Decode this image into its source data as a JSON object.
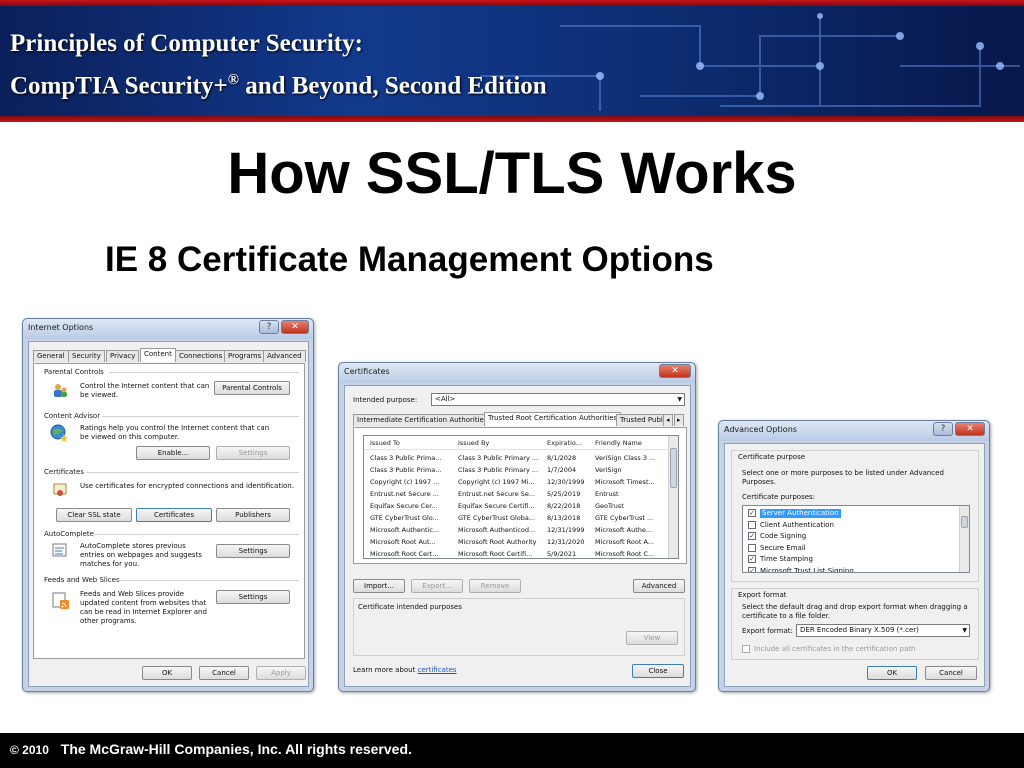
{
  "banner": {
    "line1": "Principles of Computer Security:",
    "line2_prefix": "CompTIA Security+",
    "line2_sup": "®",
    "line2_suffix": " and Beyond, Second Edition"
  },
  "slide": {
    "title": "How SSL/TLS Works",
    "subtitle": "IE 8 Certificate Management Options"
  },
  "footer": {
    "copyright": "© 2010",
    "company": "The McGraw-Hill Companies, Inc. All rights reserved."
  },
  "internet_options": {
    "title": "Internet Options",
    "tabs": [
      "General",
      "Security",
      "Privacy",
      "Content",
      "Connections",
      "Programs",
      "Advanced"
    ],
    "active_tab": "Content",
    "parental_controls": {
      "label": "Parental Controls",
      "text": "Control the Internet content that can be viewed.",
      "button": "Parental Controls"
    },
    "content_advisor": {
      "label": "Content Advisor",
      "text": "Ratings help you control the Internet content that can be viewed on this computer.",
      "enable_button": "Enable...",
      "settings_button": "Settings"
    },
    "certificates": {
      "label": "Certificates",
      "text": "Use certificates for encrypted connections and identification.",
      "clear_ssl_button": "Clear SSL state",
      "certificates_button": "Certificates",
      "publishers_button": "Publishers"
    },
    "autocomplete": {
      "label": "AutoComplete",
      "text": "AutoComplete stores previous entries on webpages and suggests matches for you.",
      "settings_button": "Settings"
    },
    "feeds": {
      "label": "Feeds and Web Slices",
      "text": "Feeds and Web Slices provide updated content from websites that can be read in Internet Explorer and other programs.",
      "settings_button": "Settings"
    },
    "ok_button": "OK",
    "cancel_button": "Cancel",
    "apply_button": "Apply"
  },
  "certificates_dialog": {
    "title": "Certificates",
    "intended_purpose_label": "Intended purpose:",
    "intended_purpose_value": "<All>",
    "tabs": [
      "Intermediate Certification Authorities",
      "Trusted Root Certification Authorities",
      "Trusted Publ"
    ],
    "active_tab": "Trusted Root Certification Authorities",
    "columns": [
      "Issued To",
      "Issued By",
      "Expiratio...",
      "Friendly Name"
    ],
    "rows": [
      [
        "Class 3 Public Prima...",
        "Class 3 Public Primary ...",
        "8/1/2028",
        "VeriSign Class 3 ..."
      ],
      [
        "Class 3 Public Prima...",
        "Class 3 Public Primary ...",
        "1/7/2004",
        "VeriSign"
      ],
      [
        "Copyright (c) 1997 ...",
        "Copyright (c) 1997 Mi...",
        "12/30/1999",
        "Microsoft Timest..."
      ],
      [
        "Entrust.net Secure ...",
        "Entrust.net Secure Se...",
        "5/25/2019",
        "Entrust"
      ],
      [
        "Equifax Secure Cer...",
        "Equifax Secure Certifi...",
        "8/22/2018",
        "GeoTrust"
      ],
      [
        "GTE CyberTrust Glo...",
        "GTE CyberTrust Globa...",
        "8/13/2018",
        "GTE CyberTrust ..."
      ],
      [
        "Microsoft Authentic...",
        "Microsoft Authenticod...",
        "12/31/1999",
        "Microsoft Authe..."
      ],
      [
        "Microsoft Root Aut...",
        "Microsoft Root Authority",
        "12/31/2020",
        "Microsoft Root A..."
      ],
      [
        "Microsoft Root Cert...",
        "Microsoft Root Certifi...",
        "5/9/2021",
        "Microsoft Root C..."
      ]
    ],
    "import_button": "Import...",
    "export_button": "Export...",
    "remove_button": "Remove",
    "advanced_button": "Advanced",
    "intended_purposes_label": "Certificate intended purposes",
    "view_button": "View",
    "learn_more_text": "Learn more about",
    "learn_more_link": "certificates",
    "close_button": "Close"
  },
  "advanced_options": {
    "title": "Advanced Options",
    "purpose_group": "Certificate purpose",
    "purpose_desc": "Select one or more purposes to be listed under Advanced Purposes.",
    "purposes_label": "Certificate purposes:",
    "purposes": [
      {
        "label": "Server Authentication",
        "checked": true
      },
      {
        "label": "Client Authentication",
        "checked": false
      },
      {
        "label": "Code Signing",
        "checked": true
      },
      {
        "label": "Secure Email",
        "checked": false
      },
      {
        "label": "Time Stamping",
        "checked": true
      },
      {
        "label": "Microsoft Trust List Signing",
        "checked": true
      }
    ],
    "export_group": "Export format",
    "export_desc": "Select the default drag and drop export format when dragging a certificate to a file folder.",
    "export_format_label": "Export format:",
    "export_format_value": "DER Encoded Binary X.509 (*.cer)",
    "include_all_label": "Include all certificates in the certification path",
    "ok_button": "OK",
    "cancel_button": "Cancel"
  },
  "colors": {
    "banner": "#123a8c",
    "banner_stripe": "#c9141b",
    "window_frame": "#c6d3e6",
    "close_button": "#c2331c"
  }
}
